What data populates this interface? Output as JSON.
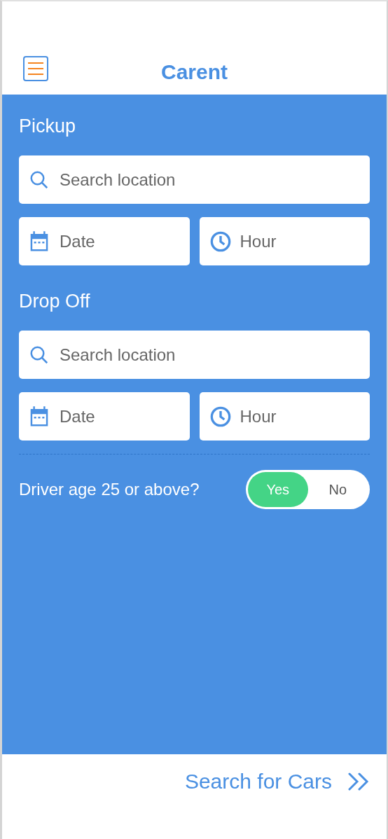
{
  "header": {
    "title": "Carent"
  },
  "sections": [
    {
      "title": "Pickup",
      "location": {
        "placeholder": "Search location"
      },
      "date": {
        "placeholder": "Date"
      },
      "hour": {
        "placeholder": "Hour"
      }
    },
    {
      "title": "Drop Off",
      "location": {
        "placeholder": "Search location"
      },
      "date": {
        "placeholder": "Date"
      },
      "hour": {
        "placeholder": "Hour"
      }
    }
  ],
  "age_question": {
    "label": "Driver age 25 or above?",
    "options": [
      {
        "label": "Yes",
        "selected": true
      },
      {
        "label": "No",
        "selected": false
      }
    ]
  },
  "footer": {
    "action": "Search for Cars"
  }
}
